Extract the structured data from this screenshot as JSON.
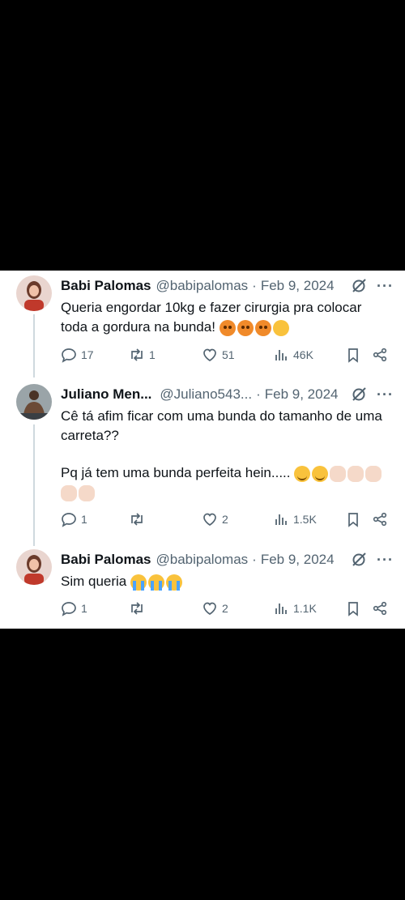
{
  "tweets": [
    {
      "name": "Babi Palomas",
      "handle": "@babipalomas",
      "dot": "·",
      "date": "Feb 9, 2024",
      "text": "Queria engordar 10kg e fazer cirurgia pra colocar toda a gordura na bunda!",
      "emojis": [
        "angry-face",
        "angry-face",
        "angry-face",
        "face-with-monocle"
      ],
      "replies": "17",
      "retweets": "1",
      "likes": "51",
      "views": "46K"
    },
    {
      "name": "Juliano Men...",
      "handle": "@Juliano543...",
      "dot": "·",
      "date": "Feb 9, 2024",
      "text_line1": "Cê tá afim ficar com uma bunda do tamanho de uma carreta??",
      "text_line2": "Pq já tem uma bunda perfeita hein.....",
      "emojis": [
        "relieved-face",
        "relieved-face",
        "clapping-hands",
        "clapping-hands",
        "clapping-hands",
        "clapping-hands",
        "clapping-hands"
      ],
      "replies": "1",
      "retweets": "",
      "likes": "2",
      "views": "1.5K"
    },
    {
      "name": "Babi Palomas",
      "handle": "@babipalomas",
      "dot": "·",
      "date": "Feb 9, 2024",
      "text": "Sim queria",
      "emojis": [
        "loudly-crying-face",
        "loudly-crying-face",
        "loudly-crying-face"
      ],
      "replies": "1",
      "retweets": "",
      "likes": "2",
      "views": "1.1K"
    }
  ],
  "more_glyph": "···",
  "colors": {
    "text": "#0f1419",
    "muted": "#536471",
    "thread": "#cfd9de",
    "background": "#000000",
    "card": "#ffffff"
  }
}
